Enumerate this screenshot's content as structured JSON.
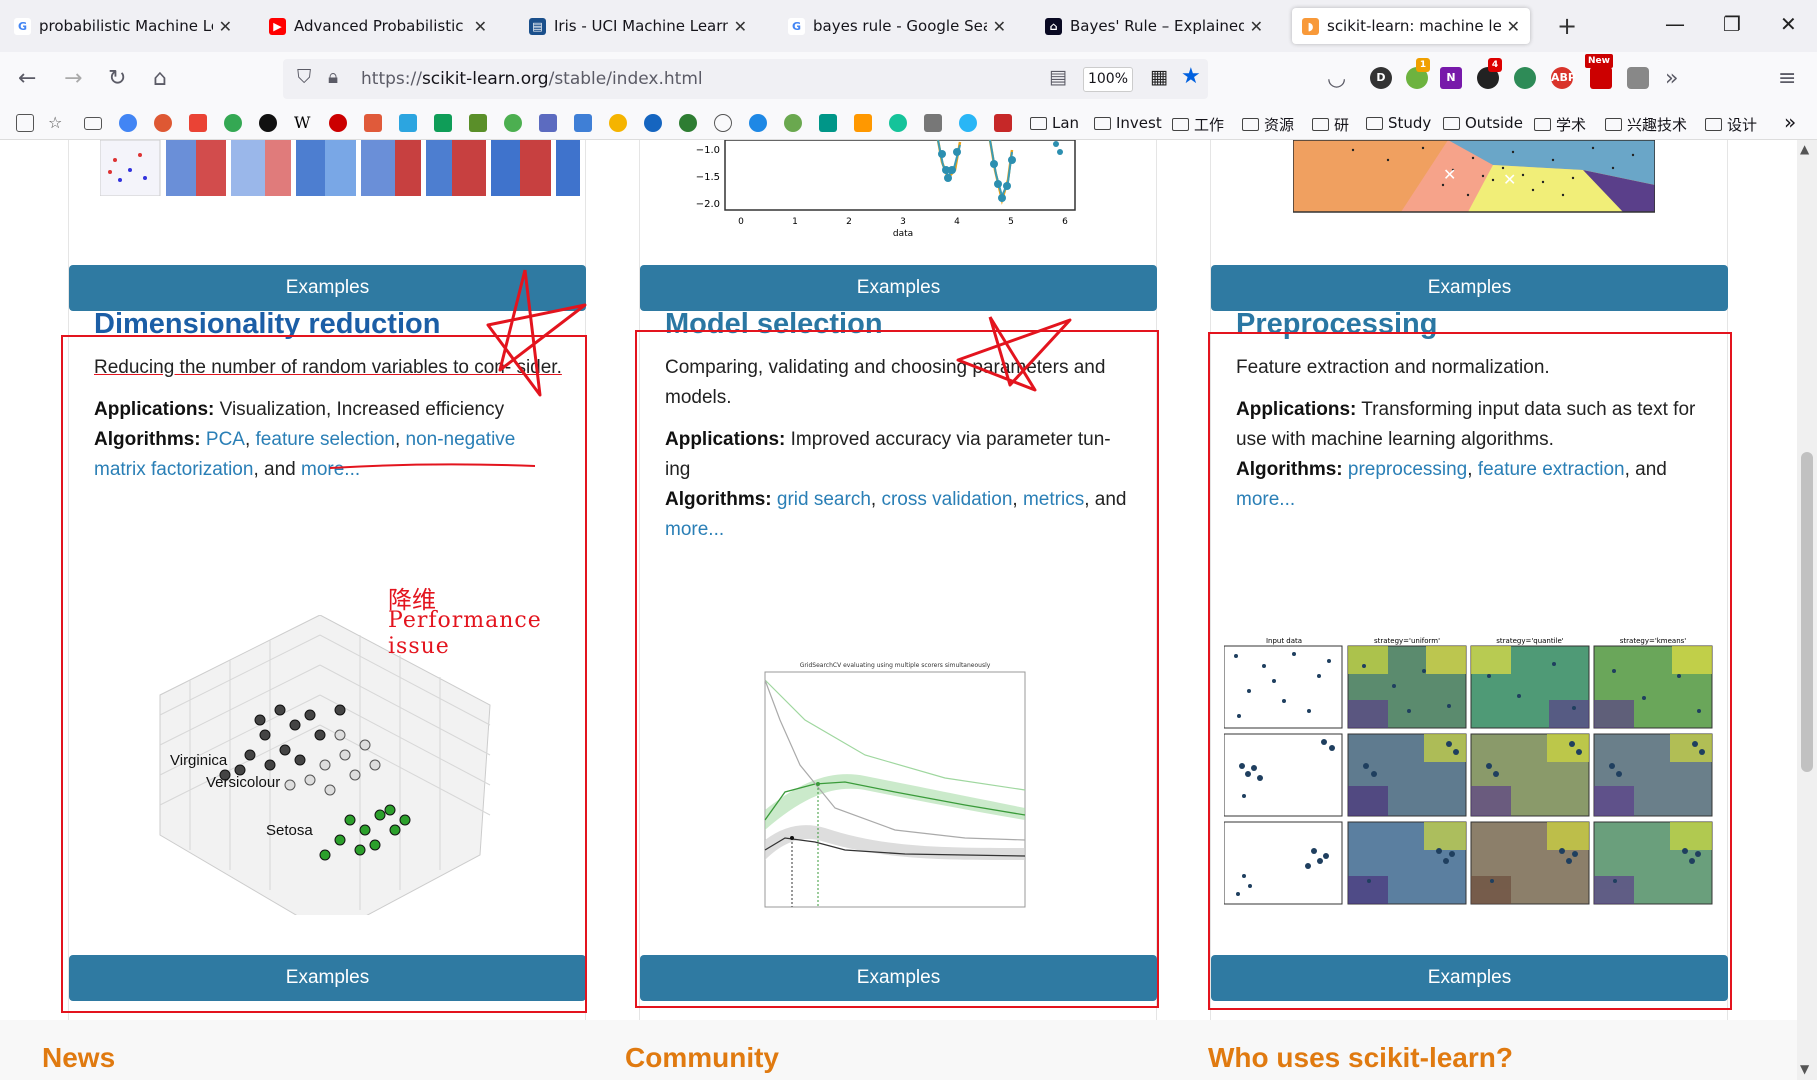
{
  "browser": {
    "tabs": [
      {
        "title": "probabilistic Machine Learni",
        "favicon": "google-icon",
        "color": "#4285f4",
        "active": false
      },
      {
        "title": "Advanced Probabilistic Mac",
        "favicon": "youtube-icon",
        "color": "#ff0000",
        "active": false
      },
      {
        "title": "Iris - UCI Machine Learning",
        "favicon": "uci-icon",
        "color": "#1a4f8b",
        "active": false
      },
      {
        "title": "bayes rule - Google Search",
        "favicon": "google-icon",
        "color": "#4285f4",
        "active": false
      },
      {
        "title": "Bayes' Rule – Explained For",
        "favicon": "freecodecamp-icon",
        "color": "#0a0a23",
        "active": false
      },
      {
        "title": "scikit-learn: machine learnin",
        "favicon": "sklearn-icon",
        "color": "#f89939",
        "active": true
      }
    ],
    "url_scheme": "https://",
    "url_host": "scikit-learn.org",
    "url_path": "/stable/index.html",
    "zoom": "100%",
    "extension_badges": {
      "first": "1",
      "second": "4",
      "third": "New"
    },
    "bookmarks": {
      "folders": [
        "Lan",
        "Invest",
        "工作",
        "资源",
        "研",
        "Study",
        "Outside",
        "学术",
        "兴趣技术",
        "设计"
      ]
    }
  },
  "page": {
    "top_row": {
      "examples_label": "Examples",
      "axis_ticks": [
        "−1.0",
        "−1.5",
        "−2.0"
      ],
      "x_ticks": [
        "0",
        "1",
        "2",
        "3",
        "4",
        "5",
        "6"
      ],
      "x_label": "data"
    },
    "cards": [
      {
        "title": "Dimensionality reduction",
        "description": "Reducing the number of random variables to con- sider.",
        "applications_label": "Applications:",
        "applications": "Visualization, Increased efficiency",
        "algorithms_label": "Algorithms:",
        "algorithms_links": [
          "PCA",
          "feature selection",
          "non-negative matrix factorization"
        ],
        "and_text": ", and",
        "more": "more...",
        "image_labels": [
          "Virginica",
          "Versicolour",
          "Setosa"
        ],
        "examples_label": "Examples"
      },
      {
        "title": "Model selection",
        "description": "Comparing, validating and choosing parameters and models.",
        "applications_label": "Applications:",
        "applications": "Improved accuracy via parameter tun- ing",
        "algorithms_label": "Algorithms:",
        "algorithms_links": [
          "grid search",
          "cross validation",
          "metrics"
        ],
        "and_text": ", and",
        "more": "more...",
        "image_title": "GridSearchCV evaluating using multiple scorers simultaneously",
        "examples_label": "Examples"
      },
      {
        "title": "Preprocessing",
        "description": "Feature extraction and normalization.",
        "applications_label": "Applications:",
        "applications": "Transforming input data such as text for use with machine learning algorithms.",
        "algorithms_label": "Algorithms:",
        "algorithms_links": [
          "preprocessing",
          "feature extraction"
        ],
        "and_text": ", and",
        "more": "more...",
        "image_col_titles": [
          "Input data",
          "strategy='uniform'",
          "strategy='quantile'",
          "strategy='kmeans'"
        ],
        "examples_label": "Examples"
      }
    ],
    "annotations": {
      "cn": "降维",
      "en1": "Performance",
      "en2": "issue"
    },
    "footer_headings": [
      "News",
      "Community",
      "Who uses scikit-learn?"
    ]
  }
}
